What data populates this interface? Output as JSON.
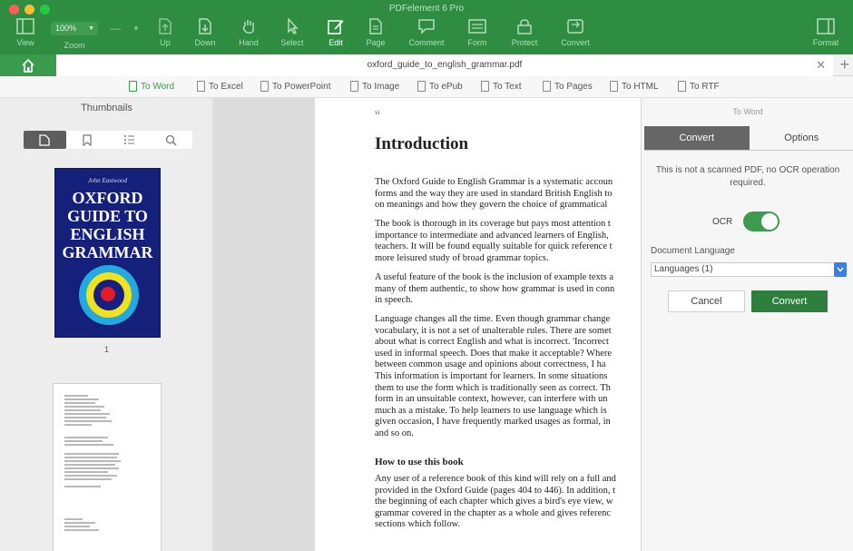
{
  "window": {
    "title": "PDFelement 6 Pro"
  },
  "toolbar": {
    "zoom_value": "100%",
    "zoom_label": "Zoom",
    "view": "View",
    "up": "Up",
    "down": "Down",
    "hand": "Hand",
    "select": "Select",
    "edit": "Edit",
    "page": "Page",
    "comment": "Comment",
    "form": "Form",
    "protect": "Protect",
    "convert": "Convert",
    "format": "Format"
  },
  "tab": {
    "filename": "oxford_guide_to_english_grammar.pdf"
  },
  "convert_bar": {
    "items": [
      "To Word",
      "To Excel",
      "To PowerPoint",
      "To Image",
      "To ePub",
      "To Text",
      "To Pages",
      "To HTML",
      "To RTF"
    ]
  },
  "left_pane": {
    "title": "Thumbnails",
    "cover": {
      "author": "John Eastwood",
      "title_lines": [
        "OXFORD",
        "GUIDE TO",
        "ENGLISH",
        "GRAMMAR"
      ]
    },
    "page_number": "1"
  },
  "document": {
    "page_tag": "vi",
    "heading": "Introduction",
    "paragraphs": [
      [
        "The Oxford Guide to English Grammar is a systematic accoun",
        "forms and the way they are used in standard British English to",
        "on meanings and how they govern the choice of grammatical"
      ],
      [
        "The book is thorough in its coverage but pays most attention t",
        "importance to intermediate and advanced learners of English,",
        "teachers. It will be found equally suitable for quick reference t",
        "more leisured study of broad grammar topics."
      ],
      [
        "A useful feature of the book is the inclusion of example texts a",
        "many of them authentic, to show how grammar is used in conn",
        "in speech."
      ],
      [
        "Language changes all the time. Even though grammar change",
        "vocabulary, it is not a set of unalterable rules. There are somet",
        "about what is correct English and what is incorrect. 'Incorrect",
        "used in informal speech. Does that make it acceptable? Where",
        "between common usage and opinions about correctness, I ha",
        "This information is important for learners. In some situations",
        "them to use the form which is traditionally seen as correct. Th",
        "form in an unsuitable context, however, can interfere with un",
        "much as a mistake. To help learners to use language which is",
        "given occasion, I have frequently marked usages as formal, in",
        "and so on."
      ]
    ],
    "subheading": "How to use this book",
    "last_paragraph": [
      "Any user of a reference book of this kind will rely on a full and",
      "provided in the Oxford Guide (pages 404 to 446). In addition, t",
      "the beginning of each chapter which gives a bird's eye view, w",
      "grammar covered in the chapter as a whole and gives referenc",
      "sections which follow."
    ]
  },
  "right_pane": {
    "title": "To Word",
    "tab_convert": "Convert",
    "tab_options": "Options",
    "message": "This is not a scanned PDF, no OCR operation required.",
    "ocr_label": "OCR",
    "ocr_on": true,
    "language_label": "Document Language",
    "language_value": "Languages (1)",
    "cancel": "Cancel",
    "convert": "Convert"
  },
  "colors": {
    "brand_green": "#2f8d42",
    "toggle_green": "#3d9a4f",
    "select_blue": "#3b7fe0"
  }
}
